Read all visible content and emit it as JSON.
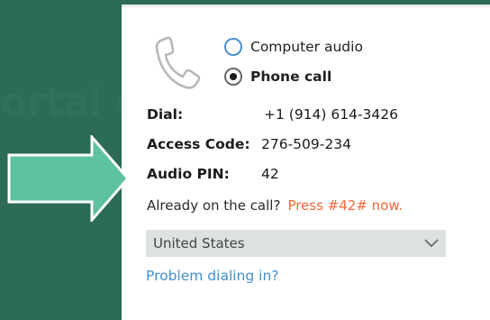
{
  "background": {
    "ghost_text": "ortal de"
  },
  "audio_options": {
    "computer_audio_label": "Computer audio",
    "phone_call_label": "Phone call",
    "selected": "Phone call"
  },
  "dial_info": {
    "dial_label": "Dial:",
    "dial_value": "+1 (914) 614-3426",
    "access_code_label": "Access Code:",
    "access_code_value": "276-509-234",
    "audio_pin_label": "Audio PIN:",
    "audio_pin_value": "42"
  },
  "already_on_call": {
    "question": "Already on the call?",
    "instruction": "Press #42# now."
  },
  "country_select": {
    "value": "United States"
  },
  "problem_link": "Problem dialing in?",
  "colors": {
    "background": "#2c6b55",
    "arrow_fill": "#5cc2a0",
    "arrow_stroke": "#ffffff",
    "accent_orange": "#f0663a",
    "link_blue": "#3f8fd0",
    "radio_blue": "#4a8fcf",
    "select_bg": "#dde1e2"
  },
  "icons": [
    "phone-icon",
    "chevron-down-icon",
    "callout-arrow"
  ]
}
